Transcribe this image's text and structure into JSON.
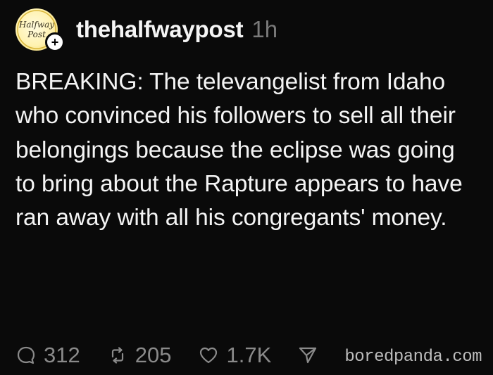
{
  "post": {
    "author": {
      "username": "thehalfwaypost",
      "timestamp": "1h",
      "avatar_text": "Halfway Post",
      "follow_icon": "plus-icon"
    },
    "text": "BREAKING: The televangelist from Idaho who convinced his followers to sell all their belongings because the eclipse was going to bring about the Rapture appears to have ran away with all his congregants' money.",
    "actions": {
      "replies": {
        "icon": "comment-icon",
        "count": "312"
      },
      "reposts": {
        "icon": "repost-icon",
        "count": "205"
      },
      "likes": {
        "icon": "heart-icon",
        "count": "1.7K"
      },
      "share": {
        "icon": "send-icon"
      }
    }
  },
  "watermark": "boredpanda.com",
  "colors": {
    "background": "#0a0a0a",
    "text": "#f4f4f4",
    "muted": "#8a8a8a",
    "avatar": "#fff2b0"
  }
}
